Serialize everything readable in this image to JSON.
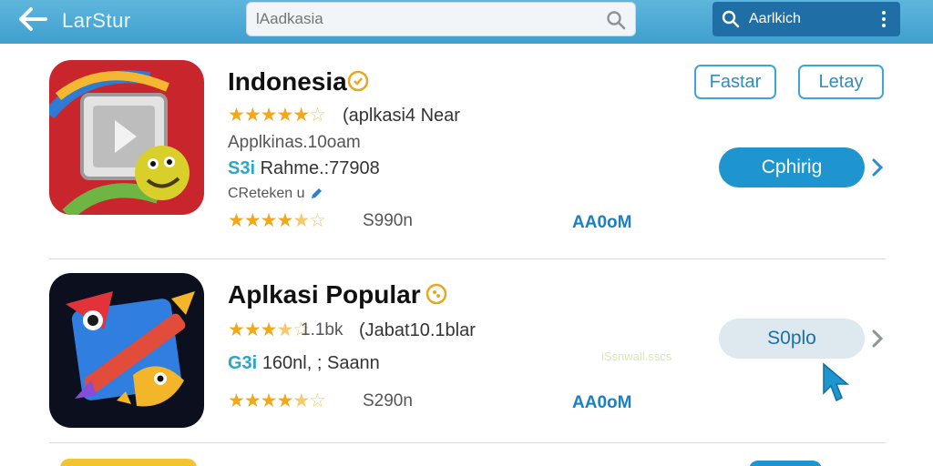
{
  "topbar": {
    "back_icon": "arrow-left-icon",
    "title": "LarStur",
    "search": {
      "value": "",
      "placeholder": "lAadkasia"
    },
    "account_label": "Aarlkich"
  },
  "apps": [
    {
      "title": "Indonesia",
      "rating_line": "(aplkasi4 Near",
      "subtitle": "Applkinas.10oam",
      "stat_prefix": "S3i",
      "stat_text": "Rahme.:77908",
      "note": "CReteken u",
      "price": "S990n",
      "size": "AA0oM",
      "outline_buttons": [
        "Fastar",
        "Letay"
      ],
      "action_button": "Cphirig",
      "rating_stars": 4.5,
      "bottom_stars": 4.5
    },
    {
      "title": "Aplkasi Popular",
      "rating_count": "1.1bk",
      "rating_line": "(Jabat10.1blar",
      "stat_prefix": "G3i",
      "stat_text": "160nl, ; Saann",
      "price": "S290n",
      "size": "AA0oM",
      "action_button": "S0plo",
      "watermark": "iSsnwall.sscs",
      "rating_stars": 3.5,
      "bottom_stars": 4.5
    }
  ],
  "colors": {
    "topbar": "#3f9fcf",
    "accent": "#1f95cf",
    "star": "#f0a81c"
  }
}
